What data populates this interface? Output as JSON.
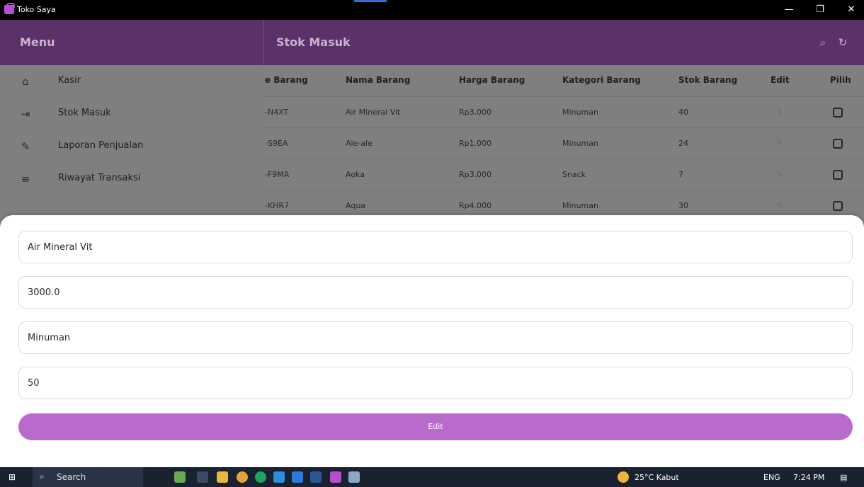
{
  "window": {
    "title": "Toko Saya",
    "minimize_icon": "—",
    "maximize_icon": "❐",
    "close_icon": "✕"
  },
  "appbar": {
    "menu_title": "Menu",
    "page_title": "Stok Masuk",
    "search_icon": "⌕",
    "refresh_icon": "↻"
  },
  "drawer": {
    "items": [
      {
        "label": "Kasir",
        "icon": "basket-icon",
        "glyph": "⌂"
      },
      {
        "label": "Stok Masuk",
        "icon": "login-icon",
        "glyph": "⇥"
      },
      {
        "label": "Laporan Penjualan",
        "icon": "edit-box-icon",
        "glyph": "✎"
      },
      {
        "label": "Riwayat Transaksi",
        "icon": "list-icon",
        "glyph": "≡"
      }
    ]
  },
  "table": {
    "headers": [
      "e Barang",
      "Nama Barang",
      "Harga Barang",
      "Kategori Barang",
      "Stok Barang",
      "Edit",
      "Pilih"
    ],
    "rows": [
      [
        "-N4XT",
        "Air Mineral Vit",
        "Rp3.000",
        "Minuman",
        "40"
      ],
      [
        "-S9EA",
        "Ale-ale",
        "Rp1.000",
        "Minuman",
        "24"
      ],
      [
        "-F9MA",
        "Aoka",
        "Rp3.000",
        "Snack",
        "7"
      ],
      [
        "-KHR7",
        "Aqua",
        "Rp4.000",
        "Minuman",
        "30"
      ]
    ],
    "edit_glyph": "✎"
  },
  "form": {
    "name": "Air Mineral Vit",
    "price": "3000.0",
    "category": "Minuman",
    "stock": "50",
    "submit_label": "Edit"
  },
  "taskbar": {
    "start_glyph": "⊞",
    "search_glyph": "⌕",
    "search_label": "Search",
    "weather": "25°C Kabut",
    "language": "ENG",
    "time": "7:24 PM",
    "notification_glyph": "▤"
  },
  "colors": {
    "appbar": "#5c3068",
    "scrim": "#7f7f7f",
    "accent_button": "#b86bcc",
    "taskbar": "#1a2230"
  }
}
